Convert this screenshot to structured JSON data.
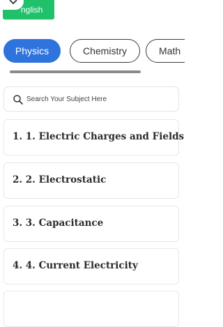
{
  "language_button": {
    "label": "nglish"
  },
  "subject_tabs": [
    {
      "label": "Physics",
      "active": true
    },
    {
      "label": "Chemistry",
      "active": false
    },
    {
      "label": "Math",
      "active": false
    }
  ],
  "search": {
    "placeholder": "Search Your Subject Here",
    "value": ""
  },
  "chapters": [
    {
      "title": "1. 1. Electric Charges and Fields"
    },
    {
      "title": "2. 2. Electrostatic"
    },
    {
      "title": "3. 3. Capacitance"
    },
    {
      "title": "4. 4. Current Electricity"
    }
  ],
  "colors": {
    "accent": "#2f73dd",
    "language_green": "#1fc16b"
  }
}
